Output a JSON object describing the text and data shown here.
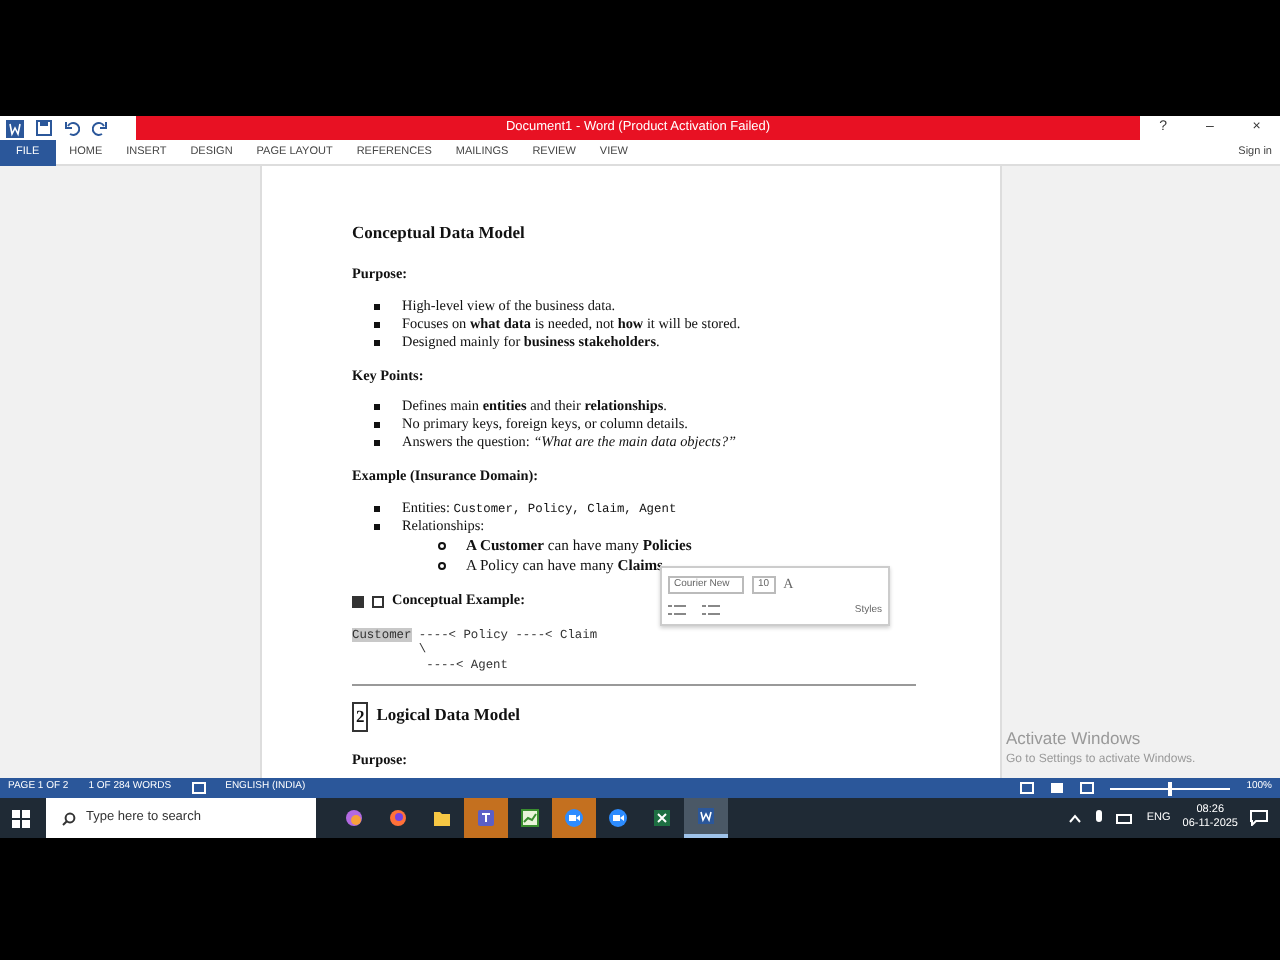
{
  "window": {
    "title": "Document1 - Word (Product Activation Failed)",
    "controls": [
      "?",
      "–",
      "×"
    ],
    "sign_in": "Sign in"
  },
  "ribbon_tabs": [
    {
      "label": "FILE",
      "selected": true
    },
    {
      "label": "HOME",
      "selected": false
    },
    {
      "label": "INSERT",
      "selected": false
    },
    {
      "label": "DESIGN",
      "selected": false
    },
    {
      "label": "PAGE LAYOUT",
      "selected": false
    },
    {
      "label": "REFERENCES",
      "selected": false
    },
    {
      "label": "MAILINGS",
      "selected": false
    },
    {
      "label": "REVIEW",
      "selected": false
    },
    {
      "label": "VIEW",
      "selected": false
    }
  ],
  "document": {
    "blocks": [
      {
        "kind": "heading",
        "text": "Conceptual Data Model"
      },
      {
        "kind": "label",
        "text": "Purpose:"
      },
      {
        "kind": "bullets",
        "items": [
          {
            "text": "High-level view of the business data."
          },
          {
            "text": "Focuses on **what data** is needed, not **how** it will be stored."
          },
          {
            "text": "Designed mainly for **business stakeholders**."
          }
        ]
      },
      {
        "kind": "label",
        "text": "Key Points:"
      },
      {
        "kind": "bullets",
        "items": [
          {
            "text": "Defines main **entities** and their **relationships**."
          },
          {
            "text": "No primary keys, foreign keys, or column details."
          },
          {
            "text": "Answers the question: *“What are the main data objects?”*"
          }
        ]
      },
      {
        "kind": "label",
        "text": "Example (Insurance Domain):"
      },
      {
        "kind": "bullets",
        "items": [
          {
            "text": "Entities:",
            "code": "Customer, Policy, Claim, Agent"
          },
          {
            "text": "Relationships:",
            "children": [
              {
                "text": "**A Customer** can have many **Policies**"
              },
              {
                "text": "A Policy can have many **Claims**"
              }
            ]
          }
        ]
      },
      {
        "kind": "label_icons",
        "text": "Conceptual Example:"
      },
      {
        "kind": "code",
        "lines": [
          {
            "segments": [
              {
                "text": "Customer",
                "selected": true
              },
              {
                "text": " ----< Policy ----< Claim",
                "selected": false
              }
            ]
          },
          {
            "segments": [
              {
                "text": "         \\",
                "selected": false
              }
            ]
          },
          {
            "segments": [
              {
                "text": "          ----< Agent",
                "selected": false
              }
            ]
          }
        ]
      },
      {
        "kind": "rule"
      },
      {
        "kind": "numbered_heading",
        "number": "2",
        "text": "Logical Data Model"
      },
      {
        "kind": "label",
        "text": "Purpose:"
      }
    ]
  },
  "mini_toolbar": {
    "font": "Courier New",
    "size": "10",
    "grow_font": "A",
    "styles": "Styles"
  },
  "activation_notice": {
    "title": "Activate Windows",
    "text": "Go to Settings to activate Windows."
  },
  "status_bar": {
    "page": "PAGE 1 OF 2",
    "words": "1 OF 284 WORDS",
    "language": "ENGLISH (INDIA)",
    "zoom": "100%",
    "zoom_slider": {
      "level": 0.5
    }
  },
  "taskbar": {
    "search": {
      "placeholder": "Type here to search"
    },
    "apps": [
      {
        "kind": "copilot",
        "flashing": false,
        "selected": false
      },
      {
        "kind": "firefox",
        "flashing": false,
        "selected": false
      },
      {
        "kind": "folder",
        "flashing": false,
        "selected": false
      },
      {
        "kind": "teams",
        "flashing": true,
        "selected": false
      },
      {
        "kind": "chart",
        "flashing": false,
        "selected": false
      },
      {
        "kind": "zoom",
        "flashing": true,
        "selected": false
      },
      {
        "kind": "zoom",
        "flashing": false,
        "selected": false
      },
      {
        "kind": "excel",
        "flashing": false,
        "selected": false
      },
      {
        "kind": "word",
        "flashing": false,
        "selected": true
      }
    ],
    "language": "ENG",
    "time": "08:26",
    "date": "06-11-2025"
  }
}
